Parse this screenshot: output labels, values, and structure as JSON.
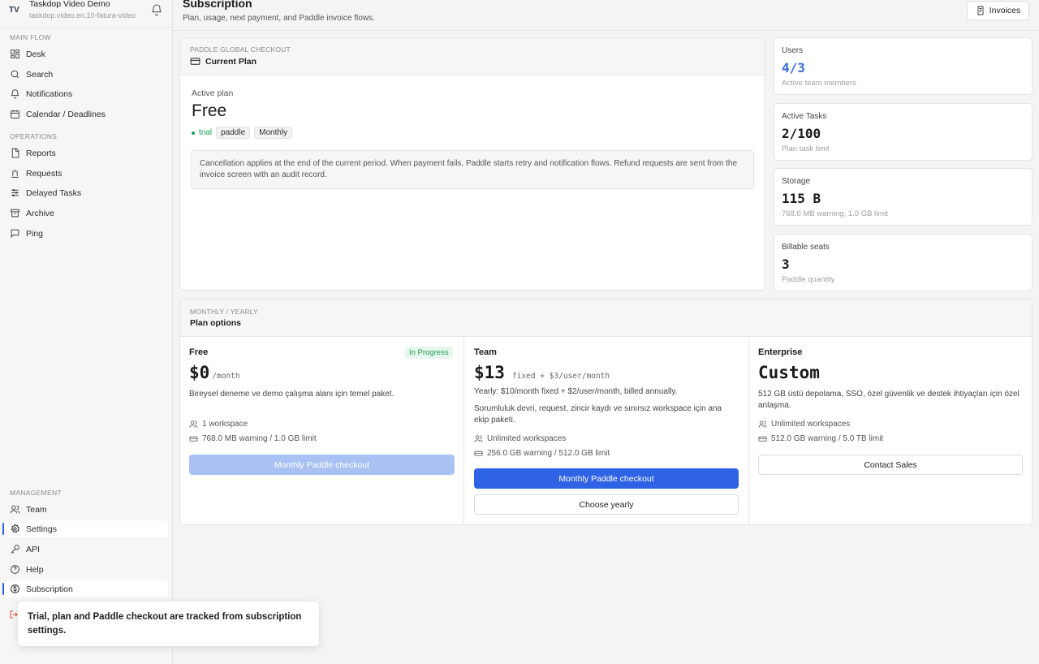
{
  "workspace": {
    "initials": "TV",
    "name": "Taskdop Video Demo",
    "subtitle": "taskdop.video.en.10-fatura-video"
  },
  "sidebar": {
    "sections": {
      "main": "MAIN FLOW",
      "operations": "OPERATIONS",
      "management": "MANAGEMENT"
    },
    "main": [
      "Desk",
      "Search",
      "Notifications",
      "Calendar / Deadlines"
    ],
    "operations": [
      "Reports",
      "Requests",
      "Delayed Tasks",
      "Archive",
      "Ping"
    ],
    "management": [
      "Team",
      "Settings",
      "API",
      "Help",
      "Subscription"
    ]
  },
  "header": {
    "title": "Subscription",
    "subtitle": "Plan, usage, next payment, and Paddle invoice flows.",
    "invoices_label": "Invoices"
  },
  "current_plan": {
    "eyebrow": "PADDLE GLOBAL CHECKOUT",
    "title": "Current Plan",
    "active_label": "Active plan",
    "plan": "Free",
    "tags": {
      "status": "trial",
      "provider": "paddle",
      "cycle": "Monthly"
    },
    "note": "Cancellation applies at the end of the current period. When payment fails, Paddle starts retry and notification flows. Refund requests are sent from the invoice screen with an audit record."
  },
  "stats": [
    {
      "label": "Users",
      "value": "4/3",
      "sub": "Active team members"
    },
    {
      "label": "Active Tasks",
      "value": "2/100",
      "sub": "Plan task limit"
    },
    {
      "label": "Storage",
      "value": "115 B",
      "sub": "768.0 MB warning, 1.0 GB limit"
    },
    {
      "label": "Billable seats",
      "value": "3",
      "sub": "Paddle quantity"
    }
  ],
  "plans_section": {
    "eyebrow": "MONTHLY / YEARLY",
    "title": "Plan options"
  },
  "plans": {
    "free": {
      "name": "Free",
      "badge": "In Progress",
      "price": "$0",
      "unit": "/month",
      "desc": "Bireysel deneme ve demo çalışma alanı için temel paket.",
      "features": [
        "1 workspace",
        "768.0 MB warning / 1.0 GB limit"
      ],
      "button": "Monthly Paddle checkout"
    },
    "team": {
      "name": "Team",
      "price": "$13",
      "unit": "fixed + $3/user/month",
      "yearly": "Yearly: $10/month fixed + $2/user/month, billed annually.",
      "desc": "Sorumluluk devri, request, zincir kaydı ve sınırsız workspace için ana ekip paketi.",
      "features": [
        "Unlimited workspaces",
        "256.0 GB warning / 512.0 GB limit"
      ],
      "button": "Monthly Paddle checkout",
      "button2": "Choose yearly"
    },
    "enterprise": {
      "name": "Enterprise",
      "price": "Custom",
      "desc": "512 GB üstü depolama, SSO, özel güvenlik ve destek ihtiyaçları için özel anlaşma.",
      "features": [
        "Unlimited workspaces",
        "512.0 GB warning / 5.0 TB limit"
      ],
      "button": "Contact Sales"
    }
  },
  "toast": "Trial, plan and Paddle checkout are tracked from subscription settings.",
  "colors": {
    "accent": "#2f63e6",
    "success": "#1f9d57",
    "users_value": "#3b6fd6"
  }
}
